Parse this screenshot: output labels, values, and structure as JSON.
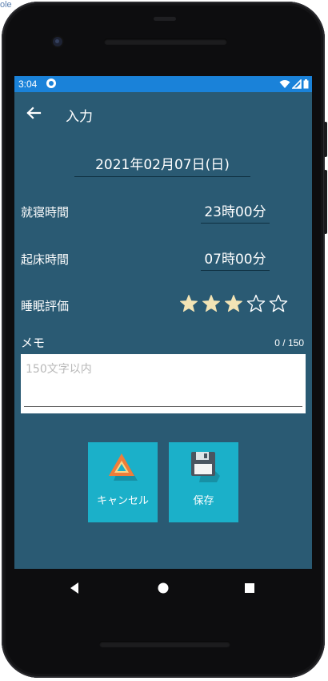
{
  "background": {
    "left_fragment": "ole"
  },
  "status_bar": {
    "time": "3:04",
    "color": "#1a82d9"
  },
  "app_bar": {
    "title": "入力",
    "back_icon": "arrow-left-icon"
  },
  "form": {
    "date": "2021年02月07日(日)",
    "bedtime": {
      "label": "就寝時間",
      "value": "23時00分"
    },
    "wakeup": {
      "label": "起床時間",
      "value": "07時00分"
    },
    "rating": {
      "label": "睡眠評価",
      "value": 3,
      "max": 5
    },
    "memo": {
      "label": "メモ",
      "counter": "0 / 150",
      "placeholder": "150文字以内",
      "value": ""
    }
  },
  "actions": {
    "cancel": {
      "label": "キャンセル",
      "icon": "warning-triangle-icon"
    },
    "save": {
      "label": "保存",
      "icon": "floppy-disk-icon"
    }
  },
  "colors": {
    "screen_bg": "#2a5a73",
    "button_bg": "#1bb0c9",
    "star_filled": "#f3e4b5"
  },
  "nav_bar": {
    "back": "back-triangle-icon",
    "home": "home-circle-icon",
    "recents": "recents-square-icon"
  }
}
